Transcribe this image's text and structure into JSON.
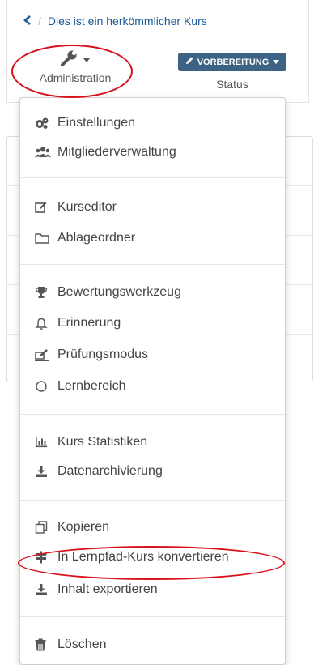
{
  "breadcrumb": {
    "back_icon": "chevron-left-icon",
    "separator": "/",
    "course_title": "Dies ist ein herkömmlicher Kurs"
  },
  "toolbar": {
    "admin_label": "Administration",
    "status_button": "VORBEREITUNG",
    "status_label": "Status",
    "colors": {
      "status_bg": "#3c6383",
      "link": "#1b5a99",
      "highlight": "#d8121b"
    }
  },
  "menu": {
    "items": [
      {
        "label": "Einstellungen",
        "icon": "gears-icon"
      },
      {
        "label": "Mitgliederverwaltung",
        "icon": "users-icon"
      },
      {
        "label": "Kurseditor",
        "icon": "edit-icon"
      },
      {
        "label": "Ablageordner",
        "icon": "folder-icon"
      },
      {
        "label": "Bewertungswerkzeug",
        "icon": "trophy-icon"
      },
      {
        "label": "Erinnerung",
        "icon": "bell-icon"
      },
      {
        "label": "Prüfungsmodus",
        "icon": "exam-edit-icon"
      },
      {
        "label": "Lernbereich",
        "icon": "circle-icon"
      },
      {
        "label": "Kurs Statistiken",
        "icon": "bar-chart-icon"
      },
      {
        "label": "Datenarchivierung",
        "icon": "download-icon"
      },
      {
        "label": "Kopieren",
        "icon": "copy-icon"
      },
      {
        "label": "In Lernpfad-Kurs konvertieren",
        "icon": "signpost-icon"
      },
      {
        "label": "Inhalt exportieren",
        "icon": "export-icon"
      },
      {
        "label": "Löschen",
        "icon": "trash-icon"
      }
    ]
  }
}
